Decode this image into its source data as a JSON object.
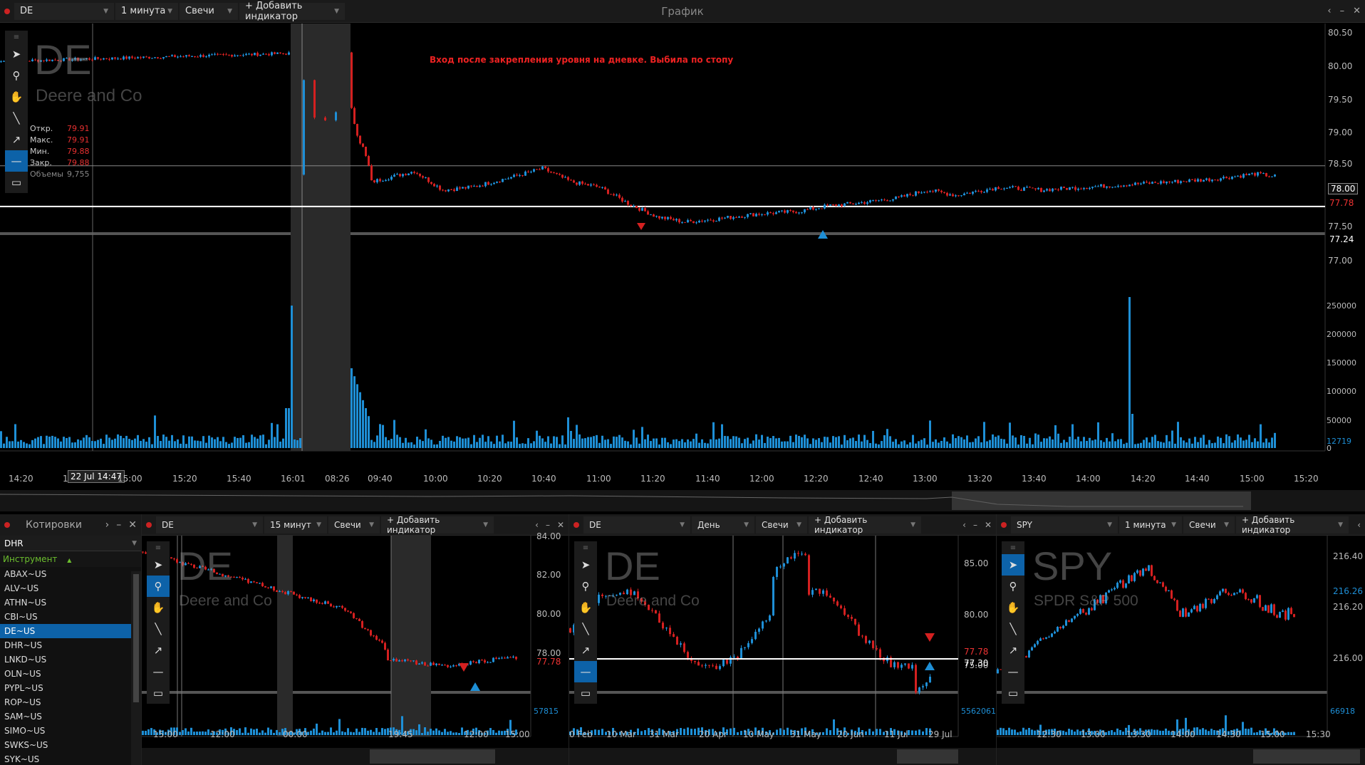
{
  "main": {
    "symbol": "DE",
    "interval": "1 минута",
    "chart_type": "Свечи",
    "add_indicator": "+ Добавить индикатор",
    "title": "График",
    "watermark_symbol": "DE",
    "watermark_name": "Deere and Co",
    "annotation": "Вход после закрепления уровня на дневке. Выбила по стопу",
    "ohlc": {
      "open_label": "Откр.",
      "open": "79.91",
      "high_label": "Макс.",
      "high": "79.91",
      "low_label": "Мин.",
      "low": "79.88",
      "close_label": "Закр.",
      "close": "79.88",
      "volume_label": "Объемы",
      "volume": "9,755"
    },
    "price_axis": [
      "80.50",
      "80.00",
      "79.50",
      "79.00",
      "78.50",
      "78.00",
      "77.50",
      "77.00"
    ],
    "price_box_top": "78.00",
    "price_last": "77.78",
    "price_level": "77.24",
    "volume_axis": [
      "250000",
      "200000",
      "150000",
      "100000",
      "50000",
      "0"
    ],
    "volume_last": "12719",
    "time_axis": [
      "14:20",
      "15:00",
      "15:20",
      "15:40",
      "16:01",
      "08:26",
      "09:40",
      "10:00",
      "10:20",
      "10:40",
      "11:00",
      "11:20",
      "11:40",
      "12:00",
      "12:20",
      "12:40",
      "13:00",
      "13:20",
      "13:40",
      "14:00",
      "14:20",
      "14:40",
      "15:00",
      "15:20"
    ],
    "cursor_time": "22 Jul 14:47",
    "cursor_time_prefix": "1"
  },
  "quotes": {
    "title": "Котировки",
    "search_value": "DHR",
    "column": "Инструмент",
    "items": [
      "ABAX~US",
      "ALV~US",
      "ATHN~US",
      "CBI~US",
      "DE~US",
      "DHR~US",
      "LNKD~US",
      "OLN~US",
      "PYPL~US",
      "ROP~US",
      "SAM~US",
      "SIMO~US",
      "SWKS~US",
      "SYK~US"
    ],
    "selected_index": 4
  },
  "chart2": {
    "symbol": "DE",
    "interval": "15 минут",
    "chart_type": "Свечи",
    "add_indicator": "+ Добавить индикатор",
    "watermark_symbol": "DE",
    "watermark_name": "Deere and Co",
    "price_axis": [
      "84.00",
      "82.00",
      "80.00",
      "78.00"
    ],
    "price_last": "77.78",
    "volume_last": "57815",
    "time_axis": [
      "15:00",
      "12:00",
      "00:00",
      "19:45",
      "12:00",
      "15:00"
    ]
  },
  "chart3": {
    "symbol": "DE",
    "interval": "День",
    "chart_type": "Свечи",
    "add_indicator": "+ Добавить индикатор",
    "watermark_symbol": "DE",
    "watermark_name": "Deere and Co",
    "price_axis": [
      "85.00",
      "80.00",
      "75.00"
    ],
    "price_last": "77.78",
    "price_level": "77.30",
    "volume_last": "5562061",
    "time_axis": [
      "0 Feb",
      "10 Mar",
      "31 Mar",
      "20 Apr",
      "10 May",
      "31 May",
      "20 Jun",
      "11 Jul",
      "29 Jul"
    ]
  },
  "chart4": {
    "symbol": "SPY",
    "interval": "1 минута",
    "chart_type": "Свечи",
    "add_indicator": "+ Добавить индикатор",
    "watermark_symbol": "SPY",
    "watermark_name": "SPDR S&P 500",
    "price_axis": [
      "216.40",
      "216.20",
      "216.00"
    ],
    "price_last": "216.26",
    "volume_last": "66918",
    "time_axis": [
      "12:30",
      "13:00",
      "13:30",
      "14:00",
      "14:30",
      "15:00",
      "15:30"
    ]
  },
  "tools": [
    "cursor-icon",
    "zoom-icon",
    "hand-icon",
    "line-icon",
    "arrow-icon",
    "hline-icon",
    "rect-icon"
  ],
  "colors": {
    "up": "#1e8fd6",
    "down": "#d42020",
    "accent": "#0d62a8",
    "level": "#ffffff"
  }
}
